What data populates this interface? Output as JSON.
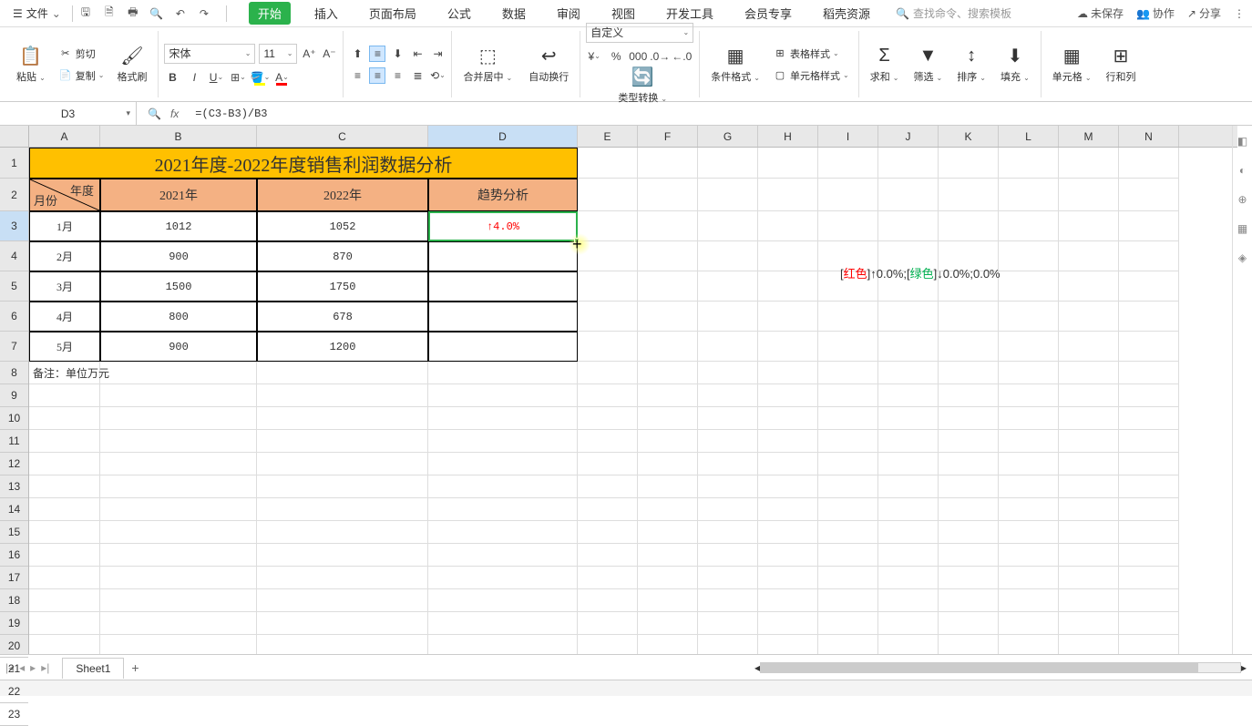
{
  "menu": {
    "file": "文件",
    "dropdown": "⌄"
  },
  "tabs": {
    "start": "开始",
    "insert": "插入",
    "layout": "页面布局",
    "formula": "公式",
    "data": "数据",
    "review": "审阅",
    "view": "视图",
    "dev": "开发工具",
    "member": "会员专享",
    "resource": "稻壳资源"
  },
  "search": {
    "placeholder": "查找命令、搜索模板"
  },
  "topRight": {
    "unsaved": "未保存",
    "coop": "协作",
    "share": "分享"
  },
  "ribbon": {
    "paste": "粘贴",
    "cut": "剪切",
    "copy": "复制",
    "formatPainter": "格式刷",
    "fontName": "宋体",
    "fontSize": "11",
    "mergeCenter": "合并居中",
    "wrap": "自动换行",
    "numberFormat": "自定义",
    "typeConvert": "类型转换",
    "condFmt": "条件格式",
    "tableStyle": "表格样式",
    "cellStyle": "单元格样式",
    "sum": "求和",
    "filter": "筛选",
    "sort": "排序",
    "fill": "填充",
    "cell": "单元格",
    "rowcol": "行和列"
  },
  "nameBox": "D3",
  "formula": "=(C3-B3)/B3",
  "cols": [
    "A",
    "B",
    "C",
    "D",
    "E",
    "F",
    "G",
    "H",
    "I",
    "J",
    "K",
    "L",
    "M",
    "N"
  ],
  "table": {
    "title": "2021年度-2022年度销售利润数据分析",
    "cornerYear": "年度",
    "cornerMonth": "月份",
    "h2021": "2021年",
    "h2022": "2022年",
    "hTrend": "趋势分析",
    "rows": [
      {
        "m": "1月",
        "y21": "1012",
        "y22": "1052",
        "trend": "↑4.0%"
      },
      {
        "m": "2月",
        "y21": "900",
        "y22": "870",
        "trend": ""
      },
      {
        "m": "3月",
        "y21": "1500",
        "y22": "1750",
        "trend": ""
      },
      {
        "m": "4月",
        "y21": "800",
        "y22": "678",
        "trend": ""
      },
      {
        "m": "5月",
        "y21": "900",
        "y22": "1200",
        "trend": ""
      }
    ],
    "note": "备注：单位万元"
  },
  "floatingFormat": {
    "p1": "[",
    "red": "红色",
    "p2": "]↑0.0%;[",
    "green": "绿色",
    "p3": "]↓0.0%;0.0%"
  },
  "sheetTab": "Sheet1"
}
